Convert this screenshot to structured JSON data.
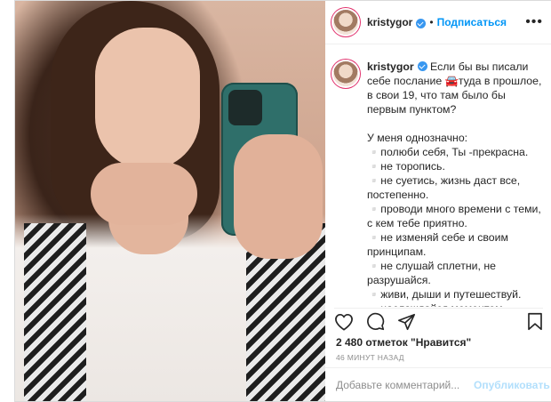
{
  "header": {
    "username": "kristygor",
    "separator": "•",
    "follow_label": "Подписаться",
    "more_label": "•••"
  },
  "caption": {
    "username": "kristygor",
    "text": "Если бы вы писали себе послание 🚘туда в прошлое, в свои 19, что там было бы первым пунктом?\n\nУ меня однозначно:\n▫️полюби себя, Ты -прекрасна.\n▫️не торопись.\n▫️не суетись, жизнь даст все, постепенно.\n▫️проводи много времени с теми, с кем тебе приятно.\n▫️не изменяй себе и своим принципам.\n▫️не слушай сплетни, не разрушайся.\n▫️живи, дыши и путешествуй.\n▫️наслаждайся моментом.\n▫️люби.\n\nИ еще много того, что казалось"
  },
  "stats": {
    "likes": "2 480 отметок \"Нравится\"",
    "time": "46 МИНУТ НАЗАД"
  },
  "comment": {
    "placeholder": "Добавьте комментарий...",
    "publish_label": "Опубликовать"
  },
  "icons": {
    "like": "heart-icon",
    "comment": "comment-icon",
    "share": "share-icon",
    "save": "bookmark-icon"
  },
  "colors": {
    "accent": "#0095f6",
    "verified": "#3897f0",
    "muted": "#8e8e8e",
    "border": "#dbdbdb"
  }
}
